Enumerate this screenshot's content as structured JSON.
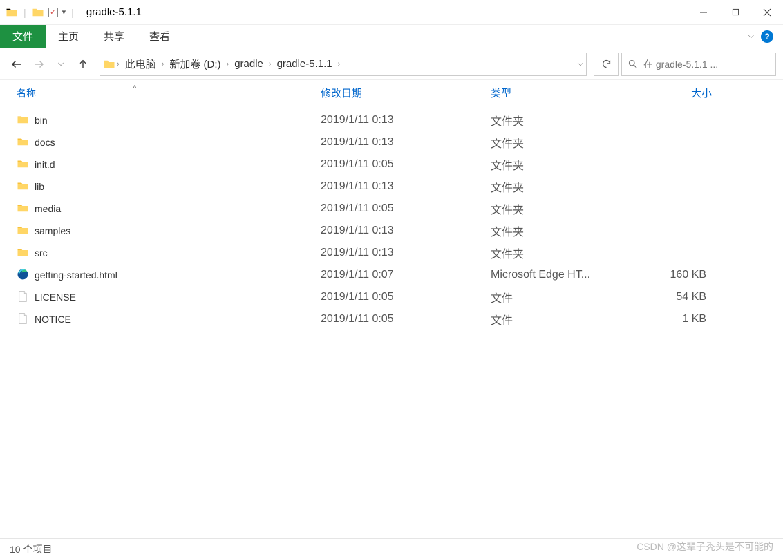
{
  "title": "gradle-5.1.1",
  "tabs": {
    "file": "文件",
    "home": "主页",
    "share": "共享",
    "view": "查看"
  },
  "breadcrumb": [
    "此电脑",
    "新加卷 (D:)",
    "gradle",
    "gradle-5.1.1"
  ],
  "search_placeholder": "在 gradle-5.1.1 ...",
  "columns": {
    "name": "名称",
    "date": "修改日期",
    "type": "类型",
    "size": "大小"
  },
  "items": [
    {
      "icon": "folder",
      "name": "bin",
      "date": "2019/1/11 0:13",
      "type": "文件夹",
      "size": ""
    },
    {
      "icon": "folder",
      "name": "docs",
      "date": "2019/1/11 0:13",
      "type": "文件夹",
      "size": ""
    },
    {
      "icon": "folder",
      "name": "init.d",
      "date": "2019/1/11 0:05",
      "type": "文件夹",
      "size": ""
    },
    {
      "icon": "folder",
      "name": "lib",
      "date": "2019/1/11 0:13",
      "type": "文件夹",
      "size": ""
    },
    {
      "icon": "folder",
      "name": "media",
      "date": "2019/1/11 0:05",
      "type": "文件夹",
      "size": ""
    },
    {
      "icon": "folder",
      "name": "samples",
      "date": "2019/1/11 0:13",
      "type": "文件夹",
      "size": ""
    },
    {
      "icon": "folder",
      "name": "src",
      "date": "2019/1/11 0:13",
      "type": "文件夹",
      "size": ""
    },
    {
      "icon": "edge",
      "name": "getting-started.html",
      "date": "2019/1/11 0:07",
      "type": "Microsoft Edge HT...",
      "size": "160 KB"
    },
    {
      "icon": "file",
      "name": "LICENSE",
      "date": "2019/1/11 0:05",
      "type": "文件",
      "size": "54 KB"
    },
    {
      "icon": "file",
      "name": "NOTICE",
      "date": "2019/1/11 0:05",
      "type": "文件",
      "size": "1 KB"
    }
  ],
  "status": "10 个项目",
  "watermark": "CSDN @这辈子秃头是不可能的"
}
